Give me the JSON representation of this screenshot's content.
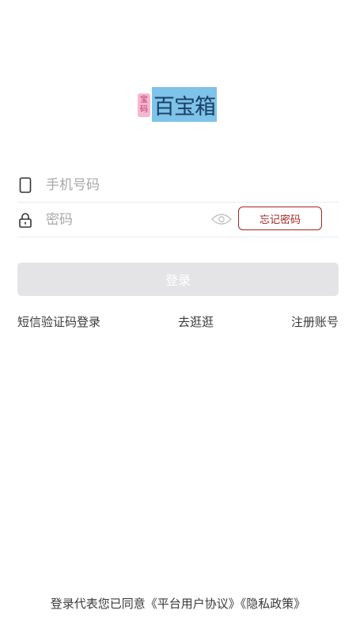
{
  "logo": {
    "badge_top": "宝",
    "badge_bottom": "码",
    "title": "百宝箱"
  },
  "phone_field": {
    "placeholder": "手机号码",
    "value": "",
    "icon": "phone-icon"
  },
  "password_field": {
    "placeholder": "密码",
    "value": "",
    "icon": "lock-icon",
    "visibility_icon": "eye-icon"
  },
  "forgot_password_label": "忘记密码",
  "login_button_label": "登录",
  "links": {
    "sms_login": "短信验证码登录",
    "browse": "去逛逛",
    "register": "注册账号"
  },
  "agreement": {
    "prefix": "登录代表您已同意",
    "terms": "《平台用户协议》",
    "privacy": "《隐私政策》"
  },
  "colors": {
    "accent": "#a42626",
    "logo_blue": "#7ec3e9",
    "logo_pink": "#f4b8cf",
    "button_disabled": "#e4e3e6"
  }
}
